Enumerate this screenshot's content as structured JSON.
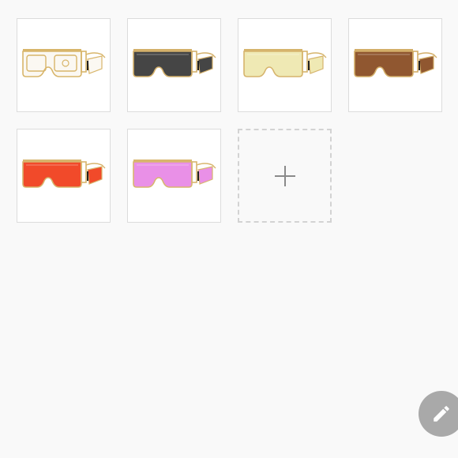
{
  "photos": [
    {
      "color": "rainbow-gold-frame",
      "lens": "#f3ecd9",
      "frame": "#d8b56a"
    },
    {
      "color": "black",
      "lens": "#3b3b3b",
      "frame": "#d4b06a"
    },
    {
      "color": "light-yellow",
      "lens": "#eee8b0",
      "frame": "#d6b46c"
    },
    {
      "color": "brown",
      "lens": "#8a4e25",
      "frame": "#d3ae68"
    },
    {
      "color": "red",
      "lens": "#f0401f",
      "frame": "#d7b46c"
    },
    {
      "color": "pink",
      "lens": "#e88ae6",
      "frame": "#d8b66e"
    }
  ],
  "add_tile": {
    "icon": "plus-icon"
  },
  "fab": {
    "icon": "pencil-icon",
    "color": "#a9a9a9"
  }
}
